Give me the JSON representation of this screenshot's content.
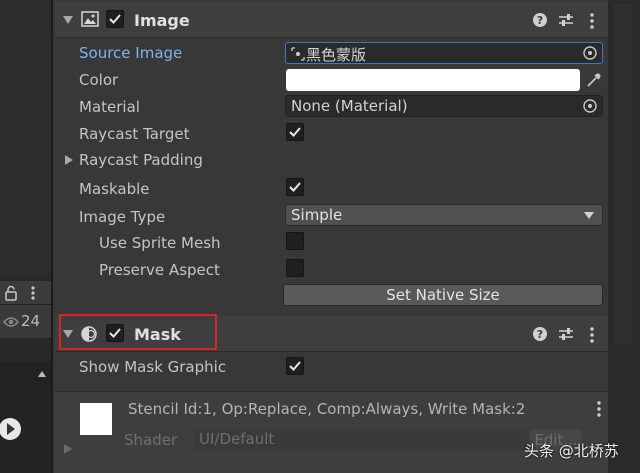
{
  "hierarchy": {
    "eye_count": "24",
    "icons": [
      "lock-icon",
      "menu-icon",
      "eye-icon",
      "up-arrow-icon",
      "play-icon"
    ]
  },
  "image_component": {
    "title": "Image",
    "enabled": true,
    "icons": [
      "image-icon",
      "help-icon",
      "preset-icon",
      "menu-icon"
    ],
    "rows": {
      "source_image": {
        "label": "Source Image",
        "value": "黑色蒙版"
      },
      "color": {
        "label": "Color",
        "value": "#ffffff"
      },
      "material": {
        "label": "Material",
        "value": "None (Material)"
      },
      "raycast_target": {
        "label": "Raycast Target",
        "checked": true
      },
      "raycast_padding": {
        "label": "Raycast Padding"
      },
      "maskable": {
        "label": "Maskable",
        "checked": true
      },
      "image_type": {
        "label": "Image Type",
        "value": "Simple"
      },
      "use_sprite_mesh": {
        "label": "Use Sprite Mesh",
        "checked": false
      },
      "preserve_aspect": {
        "label": "Preserve Aspect",
        "checked": false
      }
    },
    "set_native_size": "Set Native Size"
  },
  "mask_component": {
    "title": "Mask",
    "enabled": true,
    "icons": [
      "mask-icon",
      "help-icon",
      "preset-icon",
      "menu-icon"
    ],
    "show_mask_graphic": {
      "label": "Show Mask Graphic",
      "checked": true
    },
    "highlight_color": "#d32626"
  },
  "material_block": {
    "stencil_info": "Stencil Id:1, Op:Replace, Comp:Always, Write Mask:2",
    "shader_label": "Shader",
    "shader_value": "UI/Default",
    "edit_label": "Edit..."
  },
  "watermark": "头条 @北桥苏"
}
